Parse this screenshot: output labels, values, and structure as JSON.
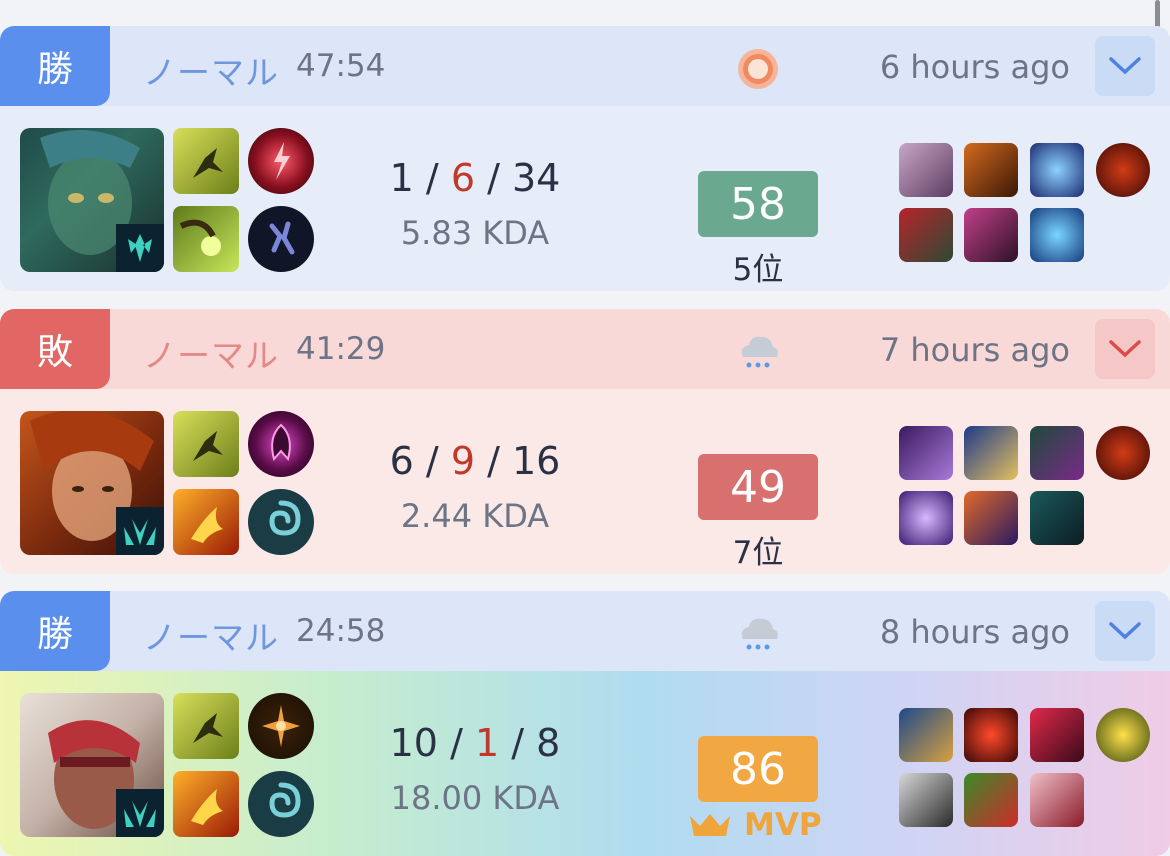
{
  "colors": {
    "win": "#5b8fee",
    "loss": "#e26663",
    "win_header": "#dde6f8",
    "win_body": "#e6edf9",
    "loss_header": "#f9d9d8",
    "loss_body": "#fbe9e7",
    "score_green": "#6aa890",
    "score_red": "#d87070",
    "score_gold": "#f1a843"
  },
  "matches": [
    {
      "result": "勝",
      "mode": "ノーマル",
      "duration": "47:54",
      "weather_icon": "sun-icon",
      "time_ago": "6 hours ago",
      "kills": "1",
      "deaths": "6",
      "assists": "34",
      "kda": "5.83 KDA",
      "score": "58",
      "rank": "5位"
    },
    {
      "result": "敗",
      "mode": "ノーマル",
      "duration": "41:29",
      "weather_icon": "rain-cloud-icon",
      "time_ago": "7 hours ago",
      "kills": "6",
      "deaths": "9",
      "assists": "16",
      "kda": "2.44 KDA",
      "score": "49",
      "rank": "7位"
    },
    {
      "result": "勝",
      "mode": "ノーマル",
      "duration": "24:58",
      "weather_icon": "rain-cloud-icon",
      "time_ago": "8 hours ago",
      "kills": "10",
      "deaths": "1",
      "assists": "8",
      "kda": "18.00 KDA",
      "score": "86",
      "mvp": "MVP"
    }
  ],
  "sep": "/"
}
